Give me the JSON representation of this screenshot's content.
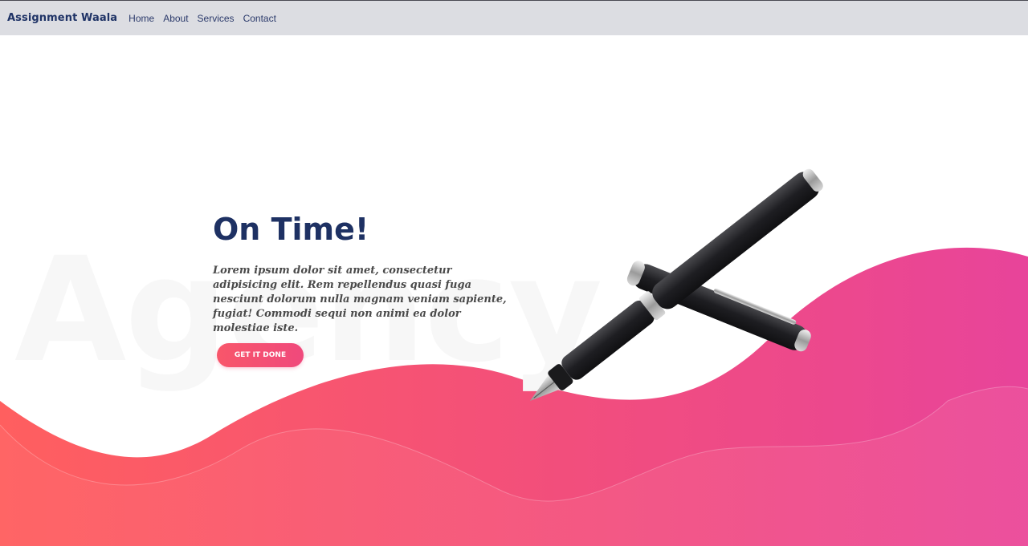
{
  "navbar": {
    "brand": "Assignment Waala",
    "links": [
      {
        "label": "Home"
      },
      {
        "label": "About"
      },
      {
        "label": "Services"
      },
      {
        "label": "Contact"
      }
    ]
  },
  "hero": {
    "watermark": "Agency",
    "title": "On Time!",
    "text": "Lorem ipsum dolor sit amet, consectetur adipisicing elit. Rem repellendus quasi fuga nesciunt dolorum nulla magnam veniam sapiente, fugiat! Commodi sequi non animi ea dolor molestiae iste.",
    "cta_label": "GET IT DONE"
  },
  "colors": {
    "brand": "#1f3366",
    "navbar_bg": "#dcdde2",
    "wave_start": "#ff5f5f",
    "wave_end": "#e8449a",
    "button": "#f5506e"
  },
  "icons": {
    "hero_image": "fountain-pen-icon"
  }
}
